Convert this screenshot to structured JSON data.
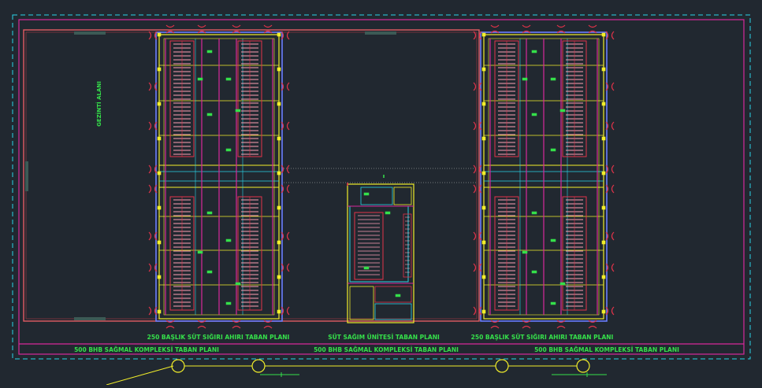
{
  "drawing": {
    "area_label": "GEZİNTİ ALANI",
    "barn_caption_left": "250 BAŞLIK SÜT SIĞIRI AHIRI TABAN PLANI",
    "milking_caption": "SÜT SAĞIM ÜNİTESİ TABAN PLANI",
    "barn_caption_right": "250 BAŞLIK SÜT SIĞIRI AHIRI TABAN PLANI",
    "complex_labels": [
      "500 BHB SAĞMAL KOMPLEKSİ TABAN PLANI",
      "500 BHB SAĞMAL KOMPLEKSİ TABAN PLANI",
      "500 BHB SAĞMAL KOMPLEKSİ TABAN PLANI"
    ]
  },
  "colors": {
    "background": "#212830",
    "border_cyan": "#2ad4e8",
    "outline_magenta": "#d8289a",
    "wall_yellow": "#f2ee2a",
    "stall_red": "#e2334a",
    "stall_pink": "#ff9fb4",
    "label_green": "#35e04a",
    "column_blue": "#6a7dff"
  }
}
